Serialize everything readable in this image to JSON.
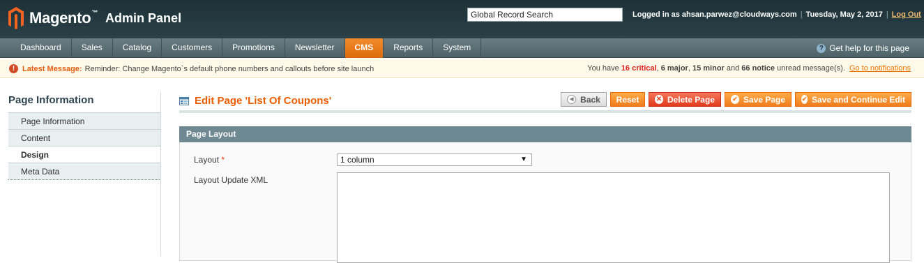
{
  "header": {
    "logo_text": "Magento",
    "logo_tm": "™",
    "logo_sub": "Admin Panel",
    "search_value": "Global Record Search",
    "logged_in_text": "Logged in as ahsan.parwez@cloudways.com",
    "date_text": "Tuesday, May 2, 2017",
    "logout_label": "Log Out",
    "separator": "|"
  },
  "nav": {
    "items": [
      {
        "label": "Dashboard"
      },
      {
        "label": "Sales"
      },
      {
        "label": "Catalog"
      },
      {
        "label": "Customers"
      },
      {
        "label": "Promotions"
      },
      {
        "label": "Newsletter"
      },
      {
        "label": "CMS"
      },
      {
        "label": "Reports"
      },
      {
        "label": "System"
      }
    ],
    "active": "CMS",
    "help_label": "Get help for this page"
  },
  "notice": {
    "label": "Latest Message:",
    "message": "Reminder: Change Magento`s default phone numbers and callouts before site launch",
    "summary_prefix": "You have",
    "critical_count": "16 critical",
    "major_text": "6 major",
    "minor_text": "15 minor",
    "notice_text": "66 notice",
    "summary_suffix": "unread message(s).",
    "link_label": "Go to notifications"
  },
  "sidebar": {
    "title": "Page Information",
    "tabs": [
      {
        "label": "Page Information"
      },
      {
        "label": "Content"
      },
      {
        "label": "Design"
      },
      {
        "label": "Meta Data"
      }
    ],
    "active_tab": "Design"
  },
  "page": {
    "title": "Edit Page 'List Of Coupons'",
    "buttons": {
      "back": "Back",
      "reset": "Reset",
      "delete": "Delete Page",
      "save": "Save Page",
      "save_continue": "Save and Continue Edit"
    }
  },
  "section": {
    "title": "Page Layout",
    "layout_label": "Layout",
    "required_mark": "*",
    "layout_value": "1 column",
    "xml_label": "Layout Update XML",
    "xml_value": ""
  },
  "colors": {
    "accent": "#eb5e00",
    "header_bg": "#243a40",
    "section_bg": "#6f8992"
  }
}
